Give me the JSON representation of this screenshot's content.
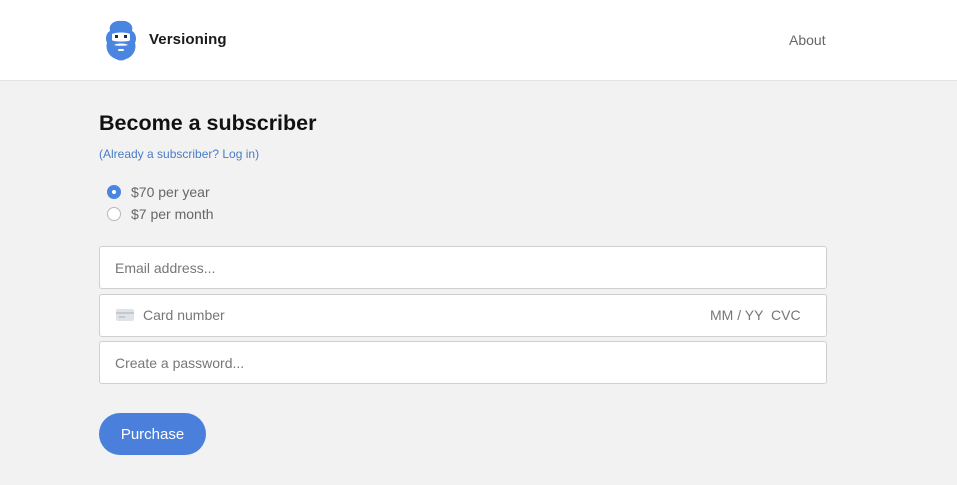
{
  "header": {
    "brand": "Versioning",
    "nav_about": "About",
    "logo_icon": "bearded-face-logo-icon",
    "logo_color": "#4a86e0"
  },
  "main": {
    "title": "Become a subscriber",
    "login_link": "(Already a subscriber? Log in)",
    "plans": [
      {
        "label": "$70 per year",
        "selected": true
      },
      {
        "label": "$7 per month",
        "selected": false
      }
    ],
    "email_placeholder": "Email address...",
    "card": {
      "icon": "credit-card-icon",
      "number_placeholder": "Card number",
      "expiry_placeholder": "MM / YY",
      "cvc_placeholder": "CVC"
    },
    "password_placeholder": "Create a password...",
    "purchase_label": "Purchase",
    "accent_color": "#4a7fdc"
  }
}
